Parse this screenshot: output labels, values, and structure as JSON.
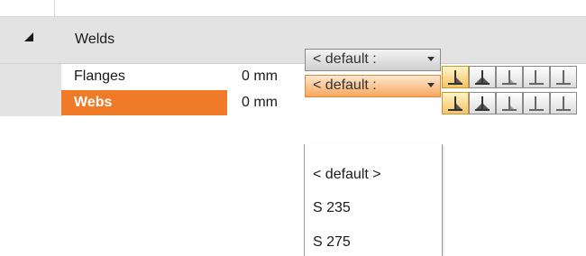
{
  "section": {
    "label": "Welds",
    "expanded": true,
    "icon": "collapse-triangle-icon"
  },
  "rows": [
    {
      "name": "Flanges",
      "value": "0 mm",
      "combo": "< default :",
      "selected": false
    },
    {
      "name": "Webs",
      "value": "0 mm",
      "combo": "< default :",
      "selected": true
    }
  ],
  "weld_buttons": [
    "fillet-weld-one-side-icon",
    "fillet-weld-both-sides-icon",
    "weld-type-3-icon",
    "weld-type-4-icon"
  ],
  "dropdown": {
    "options": [
      "< default >",
      "S 235",
      "S 275"
    ]
  },
  "colors": {
    "selected_row": "#ef7a27",
    "section_bg": "#e3e3e3",
    "button_active": "#f4c46a"
  }
}
